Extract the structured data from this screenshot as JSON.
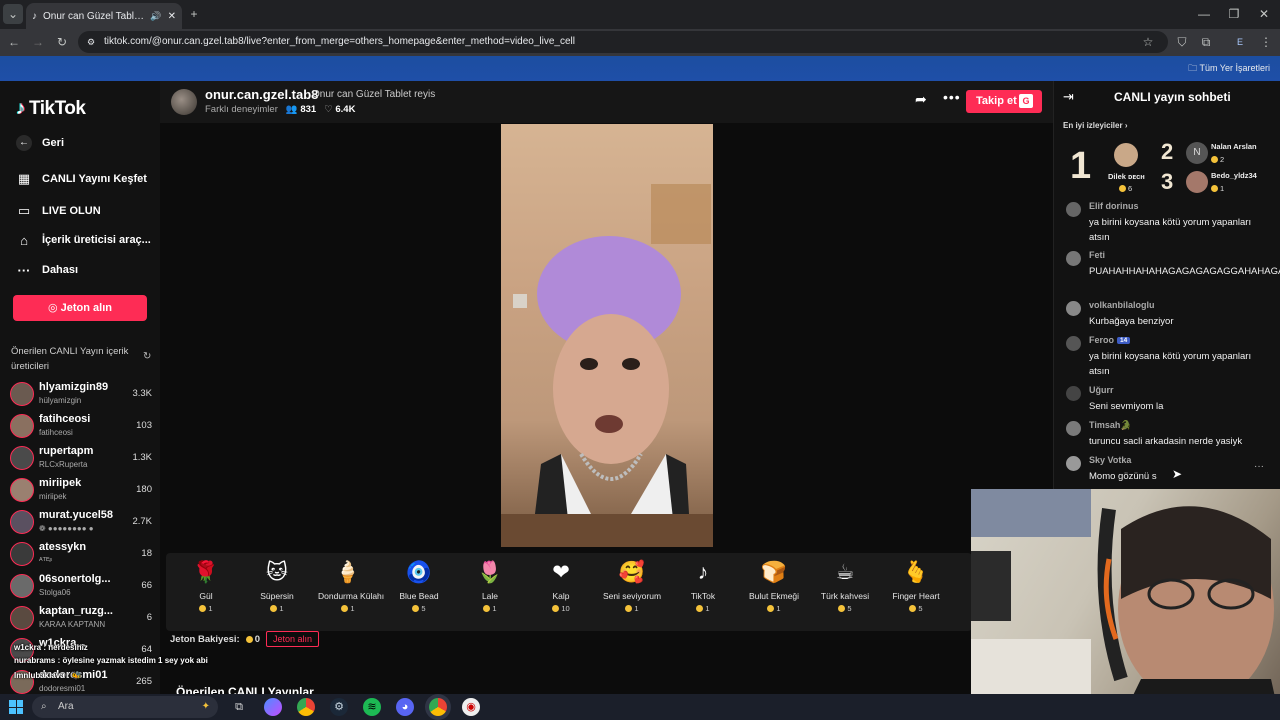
{
  "browser": {
    "tab_title": "Onur can Güzel Tablet reyis",
    "url": "tiktok.com/@onur.can.gzel.tab8/live?enter_from_merge=others_homepage&enter_method=video_live_cell",
    "bookmarks_label": "Tüm Yer İşaretleri",
    "profile_initial": "E"
  },
  "sidebar": {
    "logo": "TikTok",
    "nav": [
      {
        "label": "Geri",
        "icon": "arrow-left-icon"
      },
      {
        "label": "CANLI Yayını Keşfet",
        "icon": "live-calendar-icon"
      },
      {
        "label": "LIVE OLUN",
        "icon": "video-camera-icon"
      },
      {
        "label": "İçerik üreticisi araç...",
        "icon": "lightbulb-icon"
      },
      {
        "label": "Dahası",
        "icon": "more-dots-icon"
      }
    ],
    "coin_button": "Jeton alın",
    "suggested_title": "Önerilen CANLI Yayın içerik üreticileri",
    "creators": [
      {
        "name": "hlyamizgin89",
        "handle": "hülyamizgin",
        "viewers": "3.3K"
      },
      {
        "name": "fatihceosi",
        "handle": "fatihceosi",
        "viewers": "103"
      },
      {
        "name": "rupertapm",
        "handle": "RLCxRuperta",
        "viewers": "1.3K"
      },
      {
        "name": "miriipek",
        "handle": "miriipek",
        "viewers": "180"
      },
      {
        "name": "murat.yucel58",
        "handle": "❁ ●●●●●●●● ●",
        "viewers": "2.7K"
      },
      {
        "name": "atessykn",
        "handle": "ᴬᵀᴱᶳ",
        "viewers": "18"
      },
      {
        "name": "06sonertolg...",
        "handle": "Stolga06",
        "viewers": "66"
      },
      {
        "name": "kaptan_ruzg...",
        "handle": "KARAA KAPTANN",
        "viewers": "6"
      },
      {
        "name": "w1ckra...",
        "handle": "",
        "viewers": "64"
      },
      {
        "name": "dodoresmi01",
        "handle": "dodoresmi01",
        "viewers": "265"
      }
    ]
  },
  "live": {
    "host_name": "onur.can.gzel.tab8",
    "host_title": "Onur can Güzel Tablet reyis",
    "subtitle": "Farklı deneyimler",
    "viewers": "831",
    "likes": "6.4K",
    "follow_label": "Takip et",
    "follow_shortcut": "G"
  },
  "gifts": [
    {
      "name": "Gül",
      "price": "1",
      "icon": "🌹"
    },
    {
      "name": "Süpersin",
      "price": "1",
      "icon": "🐱"
    },
    {
      "name": "Dondurma Külahı",
      "price": "1",
      "icon": "🍦"
    },
    {
      "name": "Blue Bead",
      "price": "5",
      "icon": "🧿"
    },
    {
      "name": "Lale",
      "price": "1",
      "icon": "🌷"
    },
    {
      "name": "Kalp",
      "price": "10",
      "icon": "❤"
    },
    {
      "name": "Seni seviyorum",
      "price": "1",
      "icon": "🥰"
    },
    {
      "name": "TikTok",
      "price": "1",
      "icon": "♪"
    },
    {
      "name": "Bulut Ekmeği",
      "price": "1",
      "icon": "🍞"
    },
    {
      "name": "Türk kahvesi",
      "price": "5",
      "icon": "☕"
    },
    {
      "name": "Finger Heart",
      "price": "5",
      "icon": "🫰"
    }
  ],
  "balance": {
    "label": "Jeton Bakiyesi:",
    "value": "0",
    "button": "Jeton alın"
  },
  "recommend_title": "Önerilen CANLI Yayınlar",
  "chat": {
    "title": "CANLI yayın sohbeti",
    "top_viewers_label": "En iyi izleyiciler",
    "top_viewers": [
      {
        "rank": "1",
        "name": "Dilek ᴅᴇᴄʜ",
        "score": "6"
      },
      {
        "rank": "2",
        "name": "Nalan Arslan",
        "score": "2",
        "initial": "N"
      },
      {
        "rank": "3",
        "name": "Bedo_yldz34",
        "score": "1"
      }
    ],
    "messages": [
      {
        "user": "Elif dorinus",
        "level": "",
        "text": "ya birini koysana kötü yorum yapanları atsın"
      },
      {
        "user": "Feti",
        "level": "",
        "text": "PUAHAHHAHAHAGAGAGAGAGGAHAHAGAGAGGAGA"
      },
      {
        "user": "volkanbilaloglu",
        "level": "",
        "text": "Kurbağaya benziyor"
      },
      {
        "user": "Feroo",
        "level": "14",
        "text": "ya birini koysana kötü yorum yapanları atsın"
      },
      {
        "user": "Uğurr",
        "level": "",
        "text": "Seni sevmiyom la"
      },
      {
        "user": "Timsah🐊",
        "level": "",
        "text": "turuncu sacli arkadasin nerde yasiyk"
      },
      {
        "user": "Sky Votka",
        "level": "",
        "text": "Momo gözünü s"
      }
    ]
  },
  "overlay_chat": [
    {
      "text": "w1ckra : nerdesiniz"
    },
    {
      "text": "nurabrams : öylesine yazmak istedim 1 sey yok abi"
    },
    {
      "text": "lmnlubaklava : 🐝"
    }
  ],
  "taskbar": {
    "search_placeholder": "Ara"
  }
}
